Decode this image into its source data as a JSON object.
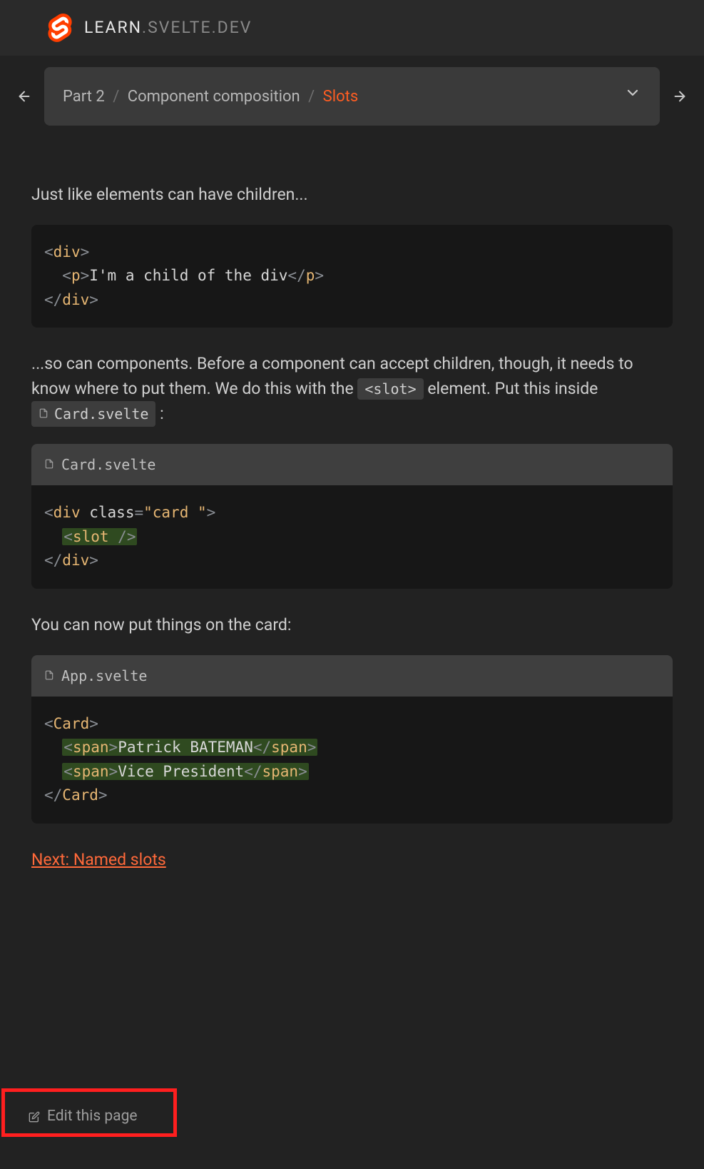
{
  "header": {
    "brand_learn": "LEARN",
    "brand_rest": ".SVELTE.DEV"
  },
  "nav": {
    "part": "Part 2",
    "section": "Component composition",
    "page": "Slots"
  },
  "content": {
    "intro": "Just like elements can have children...",
    "code1_lines": [
      [
        {
          "cls": "tok-angle",
          "t": "<"
        },
        {
          "cls": "tok-tag",
          "t": "div"
        },
        {
          "cls": "tok-angle",
          "t": ">"
        }
      ],
      [
        {
          "cls": "tok-text",
          "t": "  "
        },
        {
          "cls": "tok-angle",
          "t": "<"
        },
        {
          "cls": "tok-tag",
          "t": "p"
        },
        {
          "cls": "tok-angle",
          "t": ">"
        },
        {
          "cls": "tok-text",
          "t": "I'm a child of the div"
        },
        {
          "cls": "tok-angle",
          "t": "</"
        },
        {
          "cls": "tok-tag",
          "t": "p"
        },
        {
          "cls": "tok-angle",
          "t": ">"
        }
      ],
      [
        {
          "cls": "tok-angle",
          "t": "</"
        },
        {
          "cls": "tok-tag",
          "t": "div"
        },
        {
          "cls": "tok-angle",
          "t": ">"
        }
      ]
    ],
    "para2_a": "...so can components. Before a component can accept children, though, it needs to know where to put them. We do this with the ",
    "para2_slot": "<slot>",
    "para2_b": " element. Put this inside ",
    "para2_file": "Card.svelte",
    "para2_c": " :",
    "file2": "Card.svelte",
    "code2_lines": [
      [
        {
          "cls": "tok-angle",
          "t": "<"
        },
        {
          "cls": "tok-tag",
          "t": "div"
        },
        {
          "cls": "tok-text",
          "t": " "
        },
        {
          "cls": "tok-attr",
          "t": "class"
        },
        {
          "cls": "tok-angle",
          "t": "="
        },
        {
          "cls": "tok-str",
          "t": "\"card \""
        },
        {
          "cls": "tok-angle",
          "t": ">"
        }
      ],
      [
        {
          "cls": "tok-text",
          "t": "  "
        },
        {
          "cls": "hl",
          "t": "",
          "children": [
            {
              "cls": "tok-angle",
              "t": "<"
            },
            {
              "cls": "tok-tag",
              "t": "slot "
            },
            {
              "cls": "tok-angle",
              "t": "/>"
            }
          ]
        }
      ],
      [
        {
          "cls": "tok-angle",
          "t": "</"
        },
        {
          "cls": "tok-tag",
          "t": "div"
        },
        {
          "cls": "tok-angle",
          "t": ">"
        }
      ]
    ],
    "para3": "You can now put things on the card:",
    "file3": "App.svelte",
    "code3_lines": [
      [
        {
          "cls": "tok-angle",
          "t": "<"
        },
        {
          "cls": "tok-comp",
          "t": "Card"
        },
        {
          "cls": "tok-angle",
          "t": ">"
        }
      ],
      [
        {
          "cls": "tok-text",
          "t": "  "
        },
        {
          "cls": "hl",
          "t": "",
          "children": [
            {
              "cls": "tok-angle",
              "t": "<"
            },
            {
              "cls": "tok-tag",
              "t": "span"
            },
            {
              "cls": "tok-angle",
              "t": ">"
            },
            {
              "cls": "tok-text",
              "t": "Patrick BATEMAN"
            },
            {
              "cls": "tok-angle",
              "t": "</"
            },
            {
              "cls": "tok-tag",
              "t": "span"
            },
            {
              "cls": "tok-angle",
              "t": ">"
            }
          ]
        }
      ],
      [
        {
          "cls": "tok-text",
          "t": "  "
        },
        {
          "cls": "hl",
          "t": "",
          "children": [
            {
              "cls": "tok-angle",
              "t": "<"
            },
            {
              "cls": "tok-tag",
              "t": "span"
            },
            {
              "cls": "tok-angle",
              "t": ">"
            },
            {
              "cls": "tok-text",
              "t": "Vice President"
            },
            {
              "cls": "tok-angle",
              "t": "</"
            },
            {
              "cls": "tok-tag",
              "t": "span"
            },
            {
              "cls": "tok-angle",
              "t": ">"
            }
          ]
        }
      ],
      [
        {
          "cls": "tok-angle",
          "t": "</"
        },
        {
          "cls": "tok-comp",
          "t": "Card"
        },
        {
          "cls": "tok-angle",
          "t": ">"
        }
      ]
    ],
    "next_label": "Next: Named slots"
  },
  "footer": {
    "edit": "Edit this page"
  }
}
